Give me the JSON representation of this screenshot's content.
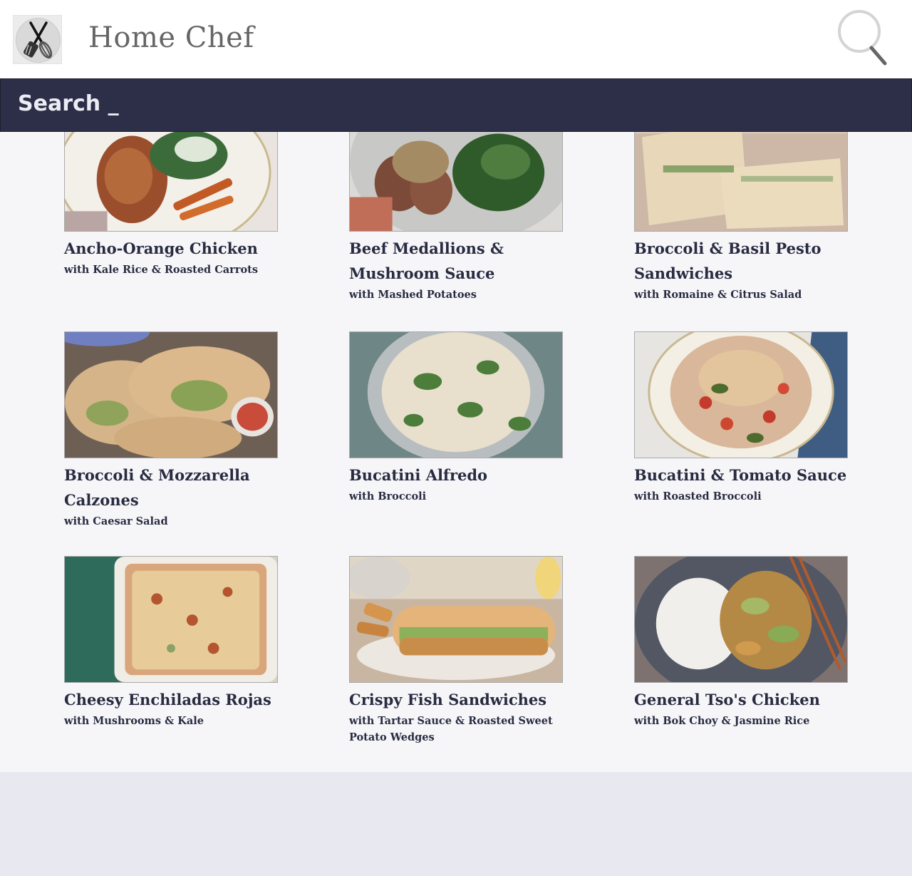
{
  "header": {
    "title": "Home Chef",
    "logo_icon": "crossed-utensils-icon",
    "search_icon": "magnifier-icon"
  },
  "search": {
    "label": "Search _"
  },
  "colors": {
    "search_bar_bg": "#2d2f48",
    "content_bg": "#f6f6f9",
    "footer_bg": "#e8e8f1",
    "title_text": "#292c41"
  },
  "recipes": [
    {
      "title": "Ancho-Orange Chicken",
      "subtitle": "with Kale Rice & Roasted Carrots"
    },
    {
      "title": "Beef Medallions & Mushroom Sauce",
      "subtitle": "with Mashed Potatoes"
    },
    {
      "title": "Broccoli & Basil Pesto Sandwiches",
      "subtitle": "with Romaine & Citrus Salad"
    },
    {
      "title": "Broccoli & Mozzarella Calzones",
      "subtitle": "with Caesar Salad"
    },
    {
      "title": "Bucatini Alfredo",
      "subtitle": "with Broccoli"
    },
    {
      "title": "Bucatini & Tomato Sauce",
      "subtitle": "with Roasted Broccoli"
    },
    {
      "title": "Cheesy Enchiladas Rojas",
      "subtitle": "with Mushrooms & Kale"
    },
    {
      "title": "Crispy Fish Sandwiches",
      "subtitle": "with Tartar Sauce & Roasted Sweet Potato Wedges"
    },
    {
      "title": "General Tso's Chicken",
      "subtitle": "with Bok Choy & Jasmine Rice"
    }
  ]
}
